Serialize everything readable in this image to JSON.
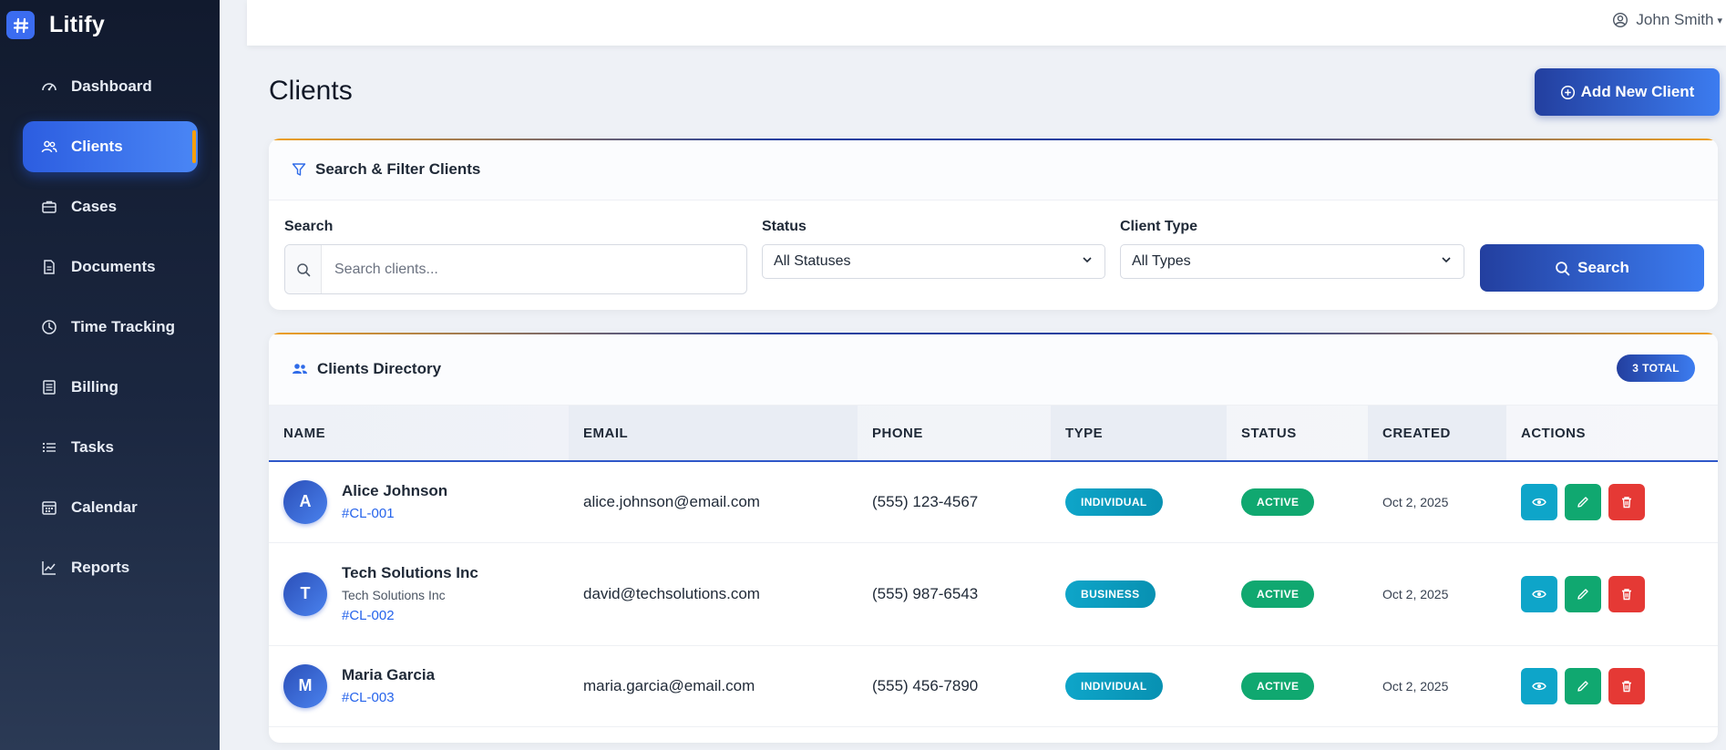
{
  "brand": {
    "name": "Litify",
    "logo_icon": "hash-icon"
  },
  "sidebar": {
    "items": [
      {
        "label": "Dashboard",
        "icon": "gauge-icon",
        "active": false
      },
      {
        "label": "Clients",
        "icon": "users-icon",
        "active": true
      },
      {
        "label": "Cases",
        "icon": "briefcase-icon",
        "active": false
      },
      {
        "label": "Documents",
        "icon": "document-icon",
        "active": false
      },
      {
        "label": "Time Tracking",
        "icon": "clock-icon",
        "active": false
      },
      {
        "label": "Billing",
        "icon": "receipt-icon",
        "active": false
      },
      {
        "label": "Tasks",
        "icon": "list-icon",
        "active": false
      },
      {
        "label": "Calendar",
        "icon": "calendar-icon",
        "active": false
      },
      {
        "label": "Reports",
        "icon": "chart-line-icon",
        "active": false
      }
    ]
  },
  "topbar": {
    "user_name": "John Smith"
  },
  "page": {
    "title": "Clients",
    "add_button": "Add New Client"
  },
  "filter": {
    "title": "Search & Filter Clients",
    "search_label": "Search",
    "search_placeholder": "Search clients...",
    "status_label": "Status",
    "status_value": "All Statuses",
    "type_label": "Client Type",
    "type_value": "All Types",
    "search_button": "Search"
  },
  "directory": {
    "title": "Clients Directory",
    "count_badge": "3 TOTAL",
    "columns": [
      "NAME",
      "EMAIL",
      "PHONE",
      "TYPE",
      "STATUS",
      "CREATED",
      "ACTIONS"
    ],
    "rows": [
      {
        "initial": "A",
        "name": "Alice Johnson",
        "company": "",
        "id": "#CL-001",
        "email": "alice.johnson@email.com",
        "phone": "(555) 123-4567",
        "type": "INDIVIDUAL",
        "status": "ACTIVE",
        "created": "Oct 2, 2025"
      },
      {
        "initial": "T",
        "name": "Tech Solutions Inc",
        "company": "Tech Solutions Inc",
        "id": "#CL-002",
        "email": "david@techsolutions.com",
        "phone": "(555) 987-6543",
        "type": "BUSINESS",
        "status": "ACTIVE",
        "created": "Oct 2, 2025"
      },
      {
        "initial": "M",
        "name": "Maria Garcia",
        "company": "",
        "id": "#CL-003",
        "email": "maria.garcia@email.com",
        "phone": "(555) 456-7890",
        "type": "INDIVIDUAL",
        "status": "ACTIVE",
        "created": "Oct 2, 2025"
      }
    ]
  },
  "colors": {
    "primary": "#233f9f",
    "accent": "#3c7cf0",
    "active_status": "#10a870",
    "type_pill": "#0ea5c9",
    "danger": "#e53935",
    "sidebar_marker": "#f59e0b"
  }
}
